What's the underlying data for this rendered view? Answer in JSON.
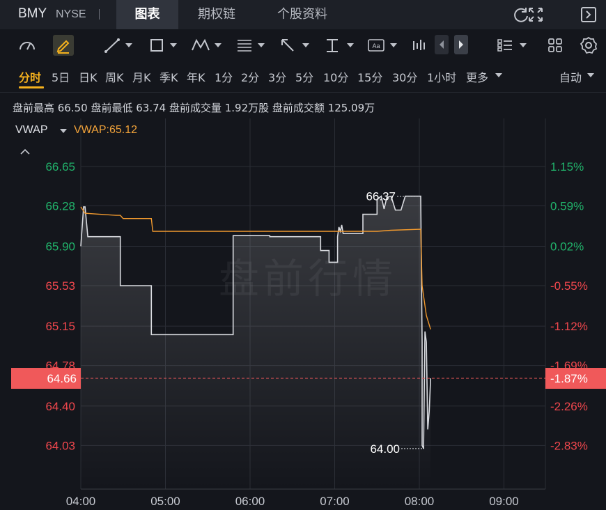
{
  "header": {
    "ticker": "BMY",
    "exchange": "NYSE",
    "tabs": [
      {
        "label": "图表",
        "active": true
      },
      {
        "label": "期权链",
        "active": false
      },
      {
        "label": "个股资料",
        "active": false
      }
    ],
    "icons": [
      "refresh-icon",
      "fullscreen-icon",
      "collapse-panel-icon"
    ]
  },
  "toolbar": {
    "icons": [
      "gauge-icon",
      "pencil-icon",
      "line-tool-icon",
      "rectangle-tool-icon",
      "pattern-tool-icon",
      "fibonacci-tool-icon",
      "arrow-tool-icon",
      "measure-tool-icon",
      "text-tool-icon",
      "indicator-icon",
      "prev-icon",
      "next-icon",
      "list-icon",
      "grid-icon",
      "settings-icon"
    ]
  },
  "periods": {
    "items": [
      "分时",
      "5日",
      "日K",
      "周K",
      "月K",
      "季K",
      "年K",
      "1分",
      "2分",
      "3分",
      "5分",
      "10分",
      "15分",
      "30分",
      "1小时",
      "更多"
    ],
    "active": "分时",
    "mode": "自动"
  },
  "stats": {
    "text": "盘前最高 66.50  盘前最低 63.74  盘前成交量 1.92万股  盘前成交额 125.09万"
  },
  "indicator": {
    "name": "VWAP",
    "value_label": "VWAP:65.12"
  },
  "colors": {
    "up": "#21b36b",
    "down": "#f0474d",
    "vwap": "#f29a2e",
    "price_line": "#d9dbe0",
    "current_price_bg": "#f0595a",
    "grid": "#2a2d35"
  },
  "chart_data": {
    "type": "line",
    "watermark": "盘前行情",
    "x_ticks": [
      "04:00",
      "05:00",
      "06:00",
      "07:00",
      "08:00",
      "09:00"
    ],
    "y_ticks_left": [
      "66.65",
      "66.28",
      "65.90",
      "65.53",
      "65.15",
      "64.78",
      "64.40",
      "64.03"
    ],
    "y_ticks_right": [
      "1.15%",
      "0.59%",
      "0.02%",
      "-0.55%",
      "-1.12%",
      "-1.69%",
      "-2.26%",
      "-2.83%"
    ],
    "ylim": [
      63.62,
      67.1
    ],
    "current_price": "64.66",
    "current_pct": "-1.87%",
    "high_label": "66.37",
    "low_label": "64.00",
    "series": [
      {
        "name": "Price",
        "points": [
          [
            "04:00",
            65.9
          ],
          [
            "04:02",
            66.27
          ],
          [
            "04:03",
            66.27
          ],
          [
            "04:05",
            65.99
          ],
          [
            "04:28",
            65.99
          ],
          [
            "04:28",
            65.53
          ],
          [
            "04:50",
            65.53
          ],
          [
            "04:50",
            65.07
          ],
          [
            "05:48",
            65.07
          ],
          [
            "05:48",
            66.0
          ],
          [
            "06:14",
            66.0
          ],
          [
            "06:14",
            65.99
          ],
          [
            "06:50",
            65.99
          ],
          [
            "06:50",
            65.86
          ],
          [
            "06:56",
            65.86
          ],
          [
            "06:56",
            65.75
          ],
          [
            "07:02",
            65.75
          ],
          [
            "07:02",
            65.99
          ],
          [
            "07:03",
            66.08
          ],
          [
            "07:04",
            66.04
          ],
          [
            "07:05",
            66.1
          ],
          [
            "07:06",
            66.02
          ],
          [
            "07:08",
            66.02
          ],
          [
            "07:20",
            66.02
          ],
          [
            "07:20",
            66.2
          ],
          [
            "07:30",
            66.2
          ],
          [
            "07:30",
            66.34
          ],
          [
            "07:33",
            66.37
          ],
          [
            "07:35",
            66.25
          ],
          [
            "07:37",
            66.36
          ],
          [
            "07:40",
            66.37
          ],
          [
            "07:43",
            66.24
          ],
          [
            "07:47",
            66.24
          ],
          [
            "07:50",
            66.37
          ],
          [
            "08:01",
            66.37
          ],
          [
            "08:02",
            65.0
          ],
          [
            "08:02",
            64.03
          ],
          [
            "08:03",
            64.0
          ],
          [
            "08:04",
            65.1
          ],
          [
            "08:05",
            65.0
          ],
          [
            "08:06",
            64.18
          ],
          [
            "08:07",
            64.35
          ],
          [
            "08:08",
            64.66
          ]
        ]
      },
      {
        "name": "VWAP",
        "points": [
          [
            "04:00",
            66.27
          ],
          [
            "04:03",
            66.21
          ],
          [
            "04:25",
            66.19
          ],
          [
            "04:28",
            66.19
          ],
          [
            "04:30",
            66.16
          ],
          [
            "04:50",
            66.16
          ],
          [
            "04:51",
            66.04
          ],
          [
            "07:30",
            66.04
          ],
          [
            "07:40",
            66.05
          ],
          [
            "08:01",
            66.06
          ],
          [
            "08:02",
            65.53
          ],
          [
            "08:05",
            65.25
          ],
          [
            "08:08",
            65.12
          ]
        ]
      }
    ]
  }
}
